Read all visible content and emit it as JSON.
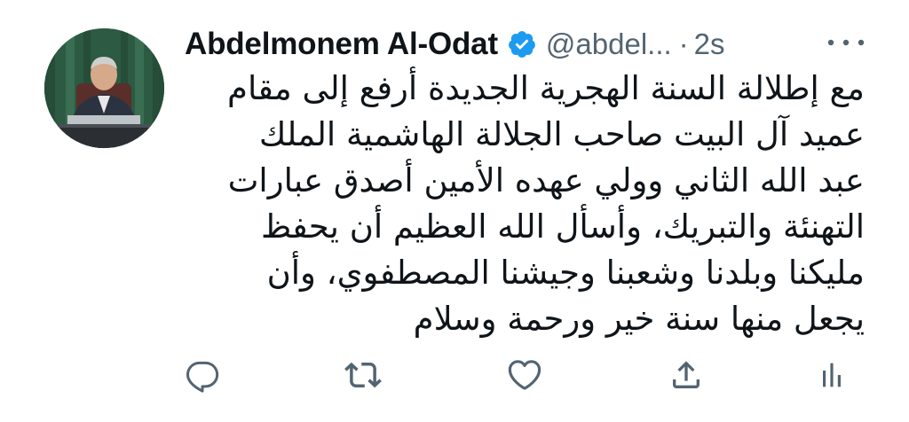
{
  "tweet": {
    "author_name": "Abdelmonem Al-Odat",
    "handle": "@abdel...",
    "separator": "·",
    "time": "2s",
    "text_lines": [
      "مع إطلالة السنة الهجرية الجديدة أرفع إلى مقام",
      "عميد آل البيت صاحب الجلالة الهاشمية الملك",
      "عبد الله الثاني وولي عهده الأمين أصدق عبارات",
      "التهنئة والتبريك، وأسأل الله العظيم أن يحفظ",
      "مليكنا وبلدنا وشعبنا وجيشنا المصطفوي، وأن",
      "يجعل منها سنة خير ورحمة وسلام"
    ]
  },
  "icons": {
    "verified": "verified-badge-icon",
    "more": "more-horizontal-icon",
    "reply": "reply-icon",
    "retweet": "retweet-icon",
    "like": "heart-icon",
    "share": "share-icon",
    "stats": "analytics-icon"
  },
  "colors": {
    "text_primary": "#0f1419",
    "text_secondary": "#536471",
    "verified_blue": "#1d9bf0",
    "background": "#ffffff"
  }
}
